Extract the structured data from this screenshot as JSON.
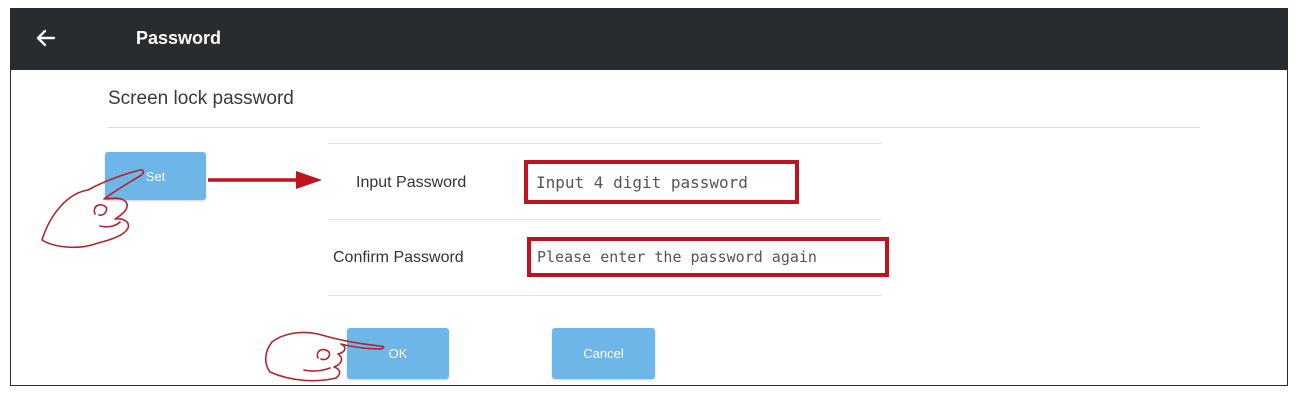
{
  "header": {
    "back_icon": "back-arrow-icon",
    "title": "Password",
    "background": "#292c2f"
  },
  "section": {
    "label": "Screen lock password"
  },
  "buttons": {
    "set_label": "Set",
    "ok_label": "OK",
    "cancel_label": "Cancel",
    "color": "#6fb6e8"
  },
  "dialog": {
    "input_label": "Input Password",
    "input_placeholder": "Input 4 digit password",
    "confirm_label": "Confirm Password",
    "confirm_placeholder": "Please enter the password again"
  },
  "annotations": {
    "highlight_color": "#c1121f",
    "pointer_icon": "pointing-hand-icon",
    "arrow_icon": "red-arrow-icon"
  }
}
